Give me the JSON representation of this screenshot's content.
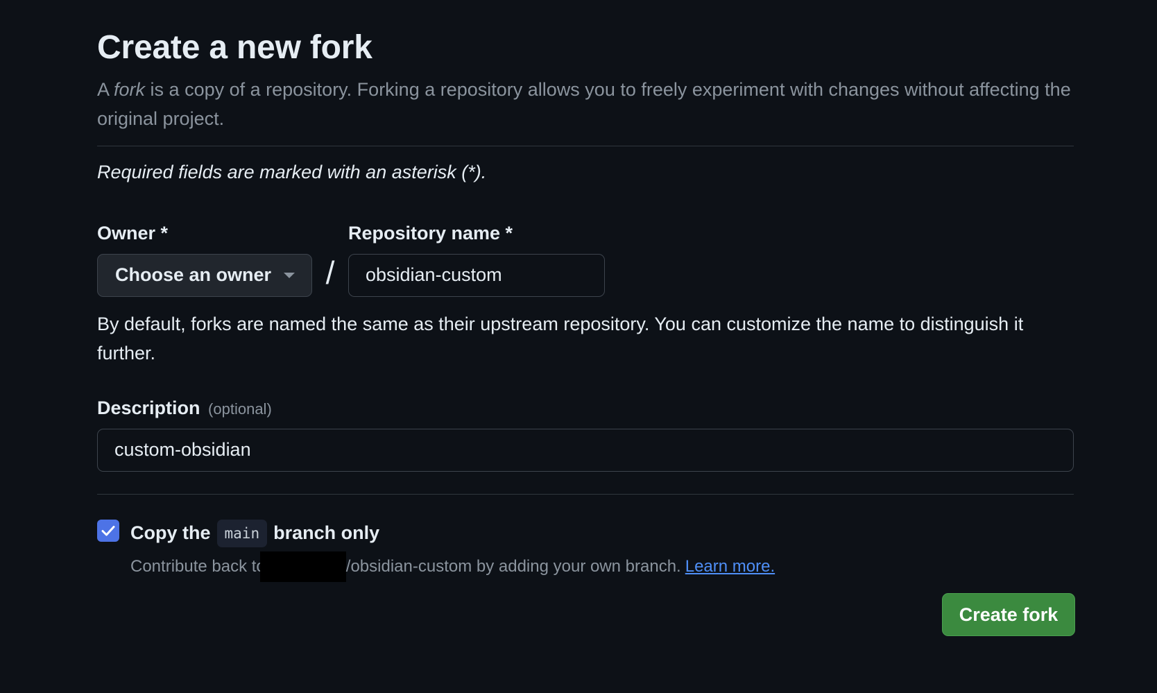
{
  "page": {
    "title": "Create a new fork",
    "subtitle_prefix": "A ",
    "subtitle_em": "fork",
    "subtitle_rest": " is a copy of a repository. Forking a repository allows you to freely experiment with changes without affecting the original project.",
    "required_note": "Required fields are marked with an asterisk (*)."
  },
  "owner": {
    "label": "Owner *",
    "button_label": "Choose an owner",
    "caret_icon": "triangle-down-icon"
  },
  "separator": "/",
  "repository": {
    "label": "Repository name *",
    "value": "obsidian-custom",
    "help": "By default, forks are named the same as their upstream repository. You can customize the name to distinguish it further."
  },
  "description": {
    "label": "Description",
    "optional": "(optional)",
    "value": "custom-obsidian"
  },
  "copy_branch": {
    "checked": true,
    "title_prefix": "Copy the",
    "branch": "main",
    "title_suffix": "branch only",
    "sub_prefix": "Contribute back to",
    "sub_repo": "/obsidian-custom by adding your own branch.",
    "learn_more": "Learn more."
  },
  "actions": {
    "create_label": "Create fork"
  },
  "colors": {
    "background": "#0d1117",
    "accent_checkbox": "#4d73e6",
    "create_button": "#3b8a3f",
    "link": "#4f8ff7"
  }
}
